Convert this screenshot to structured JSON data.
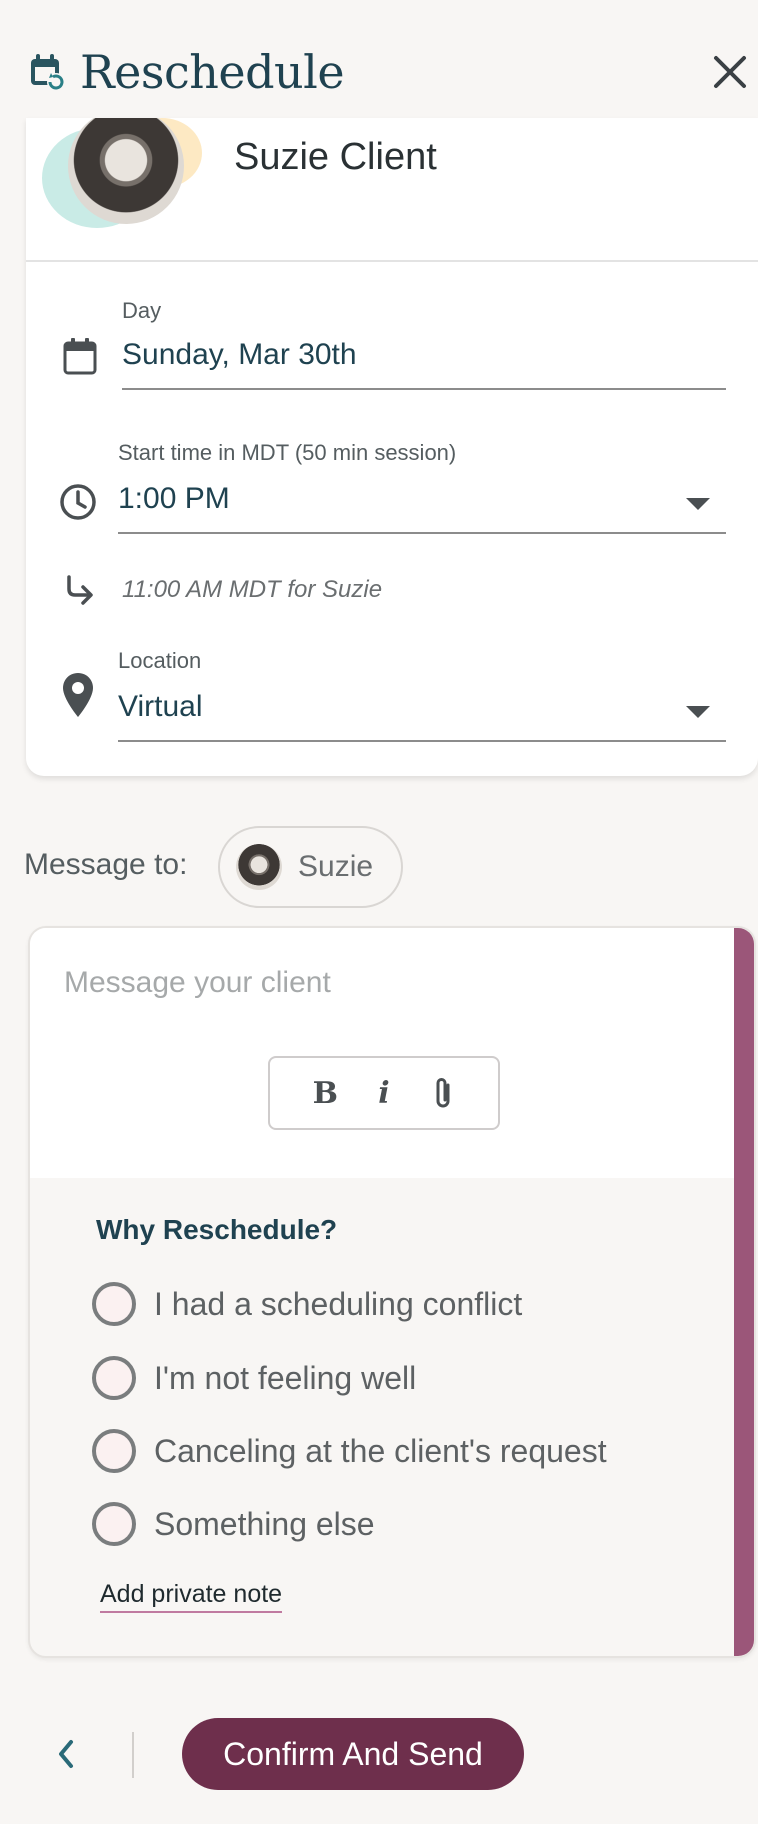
{
  "header": {
    "title": "Reschedule",
    "icon": "calendar-refresh-icon",
    "close_icon": "close-icon"
  },
  "client": {
    "name": "Suzie Client"
  },
  "fields": {
    "day": {
      "label": "Day",
      "value": "Sunday, Mar 30th",
      "icon": "calendar-icon"
    },
    "start_time": {
      "label": "Start time in MDT (50 min session)",
      "value": "1:00 PM",
      "icon": "clock-icon"
    },
    "client_time": {
      "text": "11:00 AM MDT for Suzie",
      "icon": "arrow-turn-icon"
    },
    "location": {
      "label": "Location",
      "value": "Virtual",
      "icon": "location-pin-icon"
    }
  },
  "message": {
    "to_label": "Message to:",
    "recipient": "Suzie",
    "placeholder": "Message your client",
    "toolbar": {
      "bold": "B",
      "italic": "i",
      "attach_icon": "paperclip-icon"
    }
  },
  "reasons": {
    "title": "Why Reschedule?",
    "options": [
      "I had a scheduling conflict",
      "I'm not feeling well",
      "Canceling at the client's request",
      "Something else"
    ],
    "private_note": "Add private note"
  },
  "footer": {
    "confirm_label": "Confirm And Send",
    "back_icon": "chevron-left-icon"
  },
  "colors": {
    "accent": "#9b5679",
    "primary_button": "#6e2f4c",
    "brand_text": "#1f4250",
    "icon_teal": "#2a7f86"
  }
}
